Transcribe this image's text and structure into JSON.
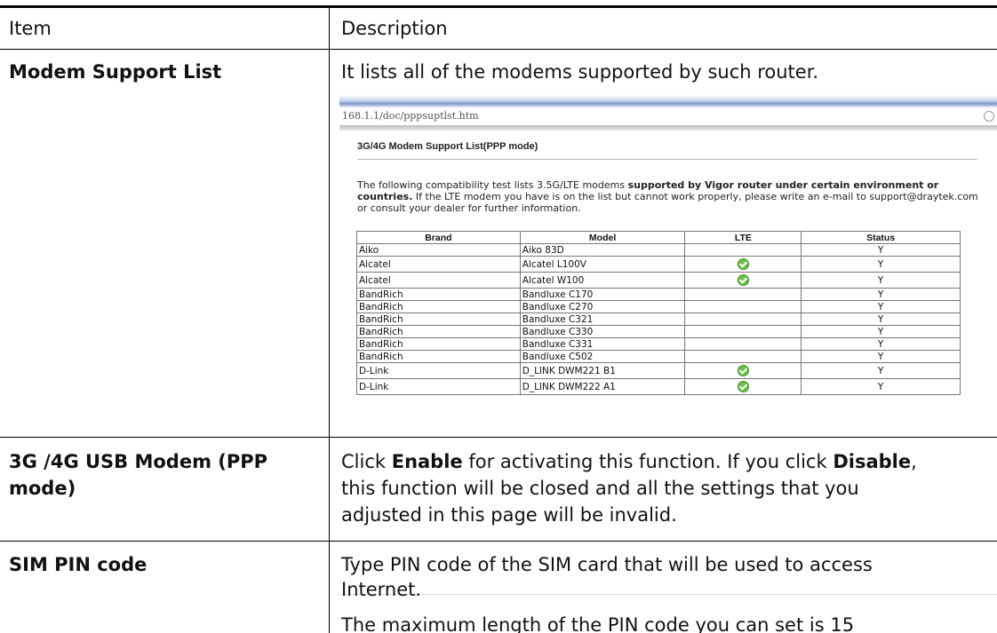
{
  "table": {
    "header": {
      "item": "Item",
      "description": "Description"
    },
    "rows": [
      {
        "item": "Modem Support List",
        "description": "It lists all of the modems supported by such router."
      },
      {
        "item_line1": "3G /4G USB Modem (PPP",
        "item_line2": "mode)",
        "desc_pre": "Click ",
        "desc_enable": "Enable",
        "desc_mid": " for activating this function. If you click ",
        "desc_disable": "Disable",
        "desc_line1_end": ",",
        "desc_line2": "this function will be closed and all the settings that you",
        "desc_line3": "adjusted in this page will be invalid."
      },
      {
        "item": "SIM PIN code",
        "desc_line1": "Type PIN code of the SIM card that will be used to access",
        "desc_line2": "Internet.",
        "desc_line3": "The maximum length of the PIN code you can set is 15"
      }
    ]
  },
  "screenshot": {
    "url": "168.1.1/doc/pppsuptlst.htm",
    "title": "3G/4G Modem Support List(PPP mode)",
    "desc_a": "The following compatibility test lists 3.5G/LTE modems ",
    "desc_b": "supported by Vigor router under certain environment or countries.",
    "desc_c": " If the LTE modem you have is on the list but cannot work properly, please write an e-mail to support@draytek.com or consult your dealer for further information.",
    "columns": [
      "Brand",
      "Model",
      "LTE",
      "Status"
    ],
    "rows": [
      {
        "brand": "Aiko",
        "model": "Aiko 83D",
        "lte": "",
        "status": "Y"
      },
      {
        "brand": "Alcatel",
        "model": "Alcatel L100V",
        "lte": "check",
        "status": "Y"
      },
      {
        "brand": "Alcatel",
        "model": "Alcatel W100",
        "lte": "check",
        "status": "Y"
      },
      {
        "brand": "BandRich",
        "model": "Bandluxe C170",
        "lte": "",
        "status": "Y"
      },
      {
        "brand": "BandRich",
        "model": "Bandluxe C270",
        "lte": "",
        "status": "Y"
      },
      {
        "brand": "BandRich",
        "model": "Bandluxe C321",
        "lte": "",
        "status": "Y"
      },
      {
        "brand": "BandRich",
        "model": "Bandluxe C330",
        "lte": "",
        "status": "Y"
      },
      {
        "brand": "BandRich",
        "model": "Bandluxe C331",
        "lte": "",
        "status": "Y"
      },
      {
        "brand": "BandRich",
        "model": "Bandluxe C502",
        "lte": "",
        "status": "Y"
      },
      {
        "brand": "D-Link",
        "model": "D_LINK DWM221 B1",
        "lte": "check",
        "status": "Y"
      },
      {
        "brand": "D-Link",
        "model": "D_LINK DWM222 A1",
        "lte": "check",
        "status": "Y"
      }
    ],
    "lte_icon": "check-circle-icon",
    "lte_icon_color": "#6cc04a"
  }
}
